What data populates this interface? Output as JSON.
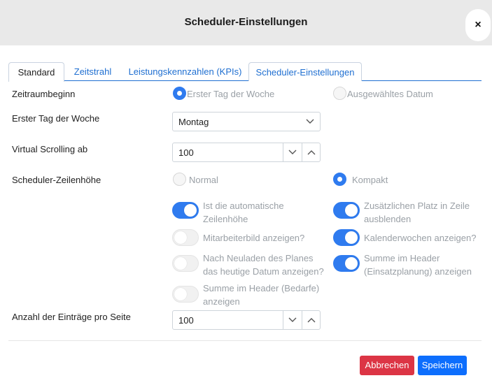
{
  "dialog": {
    "title": "Scheduler-Einstellungen",
    "close_label": "×"
  },
  "tabs": [
    {
      "label": "Standard",
      "active": true
    },
    {
      "label": "Zeitstrahl",
      "active": false
    },
    {
      "label": "Leistungskennzahlen (KPIs)",
      "active": false
    },
    {
      "label": "Scheduler-Einstellungen",
      "active": false
    }
  ],
  "fields": {
    "period_start": {
      "label": "Zeitraumbeginn",
      "options": [
        {
          "label": "Erster Tag der Woche",
          "selected": true
        },
        {
          "label": "Ausgewähltes Datum",
          "selected": false
        }
      ]
    },
    "first_weekday": {
      "label": "Erster Tag der Woche",
      "value": "Montag"
    },
    "virtual_scrolling": {
      "label": "Virtual Scrolling ab",
      "value": "100"
    },
    "row_height": {
      "label": "Scheduler-Zeilenhöhe",
      "options": [
        {
          "label": "Normal",
          "selected": false
        },
        {
          "label": "Kompakt",
          "selected": true
        }
      ]
    },
    "entries_per_page": {
      "label": "Anzahl der Einträge pro Seite",
      "value": "100"
    }
  },
  "toggles": {
    "left": [
      {
        "label_lines": [
          "Ist die automatische",
          "Zeilenhöhe"
        ],
        "on": true
      },
      {
        "label_lines": [
          "Mitarbeiterbild anzeigen?"
        ],
        "on": false
      },
      {
        "label_lines": [
          "Nach Neuladen des Planes",
          "das heutige Datum anzeigen?"
        ],
        "on": false
      },
      {
        "label_lines": [
          "Summe im Header (Bedarfe)",
          "anzeigen"
        ],
        "on": false
      }
    ],
    "right": [
      {
        "label_lines": [
          "Zusätzlichen Platz in Zeile",
          "ausblenden"
        ],
        "on": true
      },
      {
        "label_lines": [
          "Kalenderwochen anzeigen?"
        ],
        "on": true
      },
      {
        "label_lines": [
          "Summe im Header",
          "(Einsatzplanung) anzeigen"
        ],
        "on": true
      }
    ]
  },
  "footer": {
    "cancel_label": "Abbrechen",
    "save_label": "Speichern"
  },
  "colors": {
    "accent": "#2f7bef",
    "danger": "#dc3545",
    "primary": "#0d6efd",
    "tab_link": "#1f6fd1"
  }
}
